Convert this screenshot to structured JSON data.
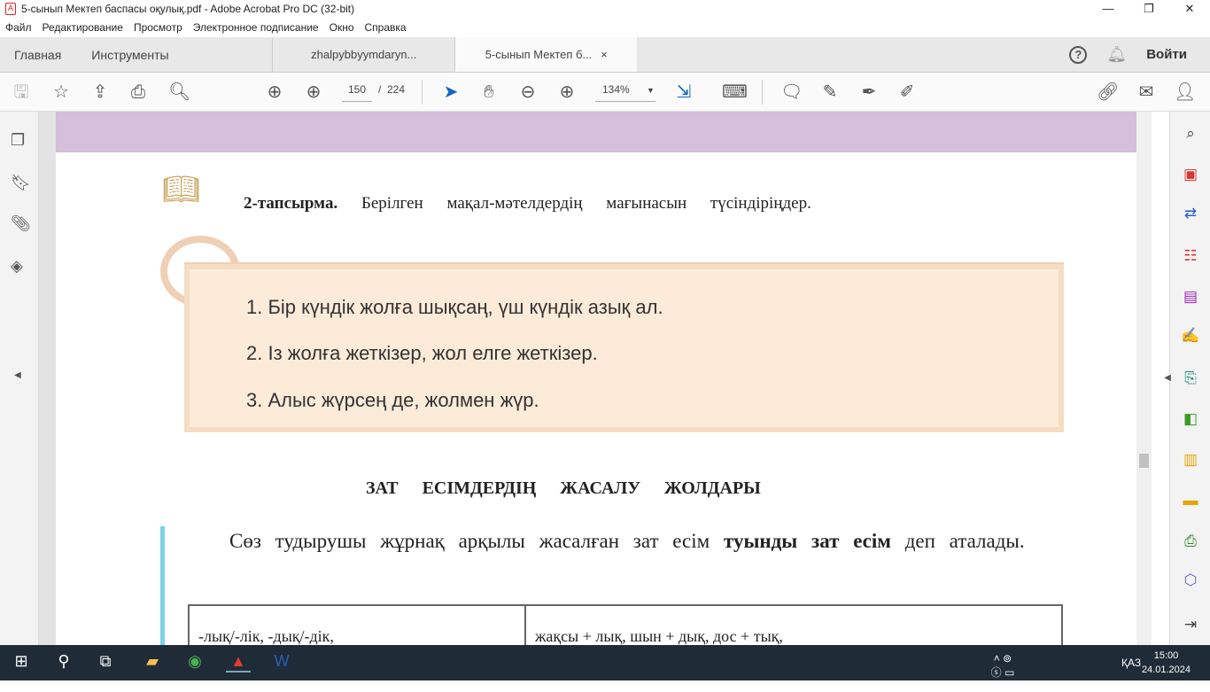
{
  "window": {
    "title": "5-сынып Мектеп баспасы оқулық.pdf - Adobe Acrobat Pro DC (32-bit)",
    "minimize": "—",
    "maximize": "❐",
    "close": "✕"
  },
  "menu": [
    "Файл",
    "Редактирование",
    "Просмотр",
    "Электронное подписание",
    "Окно",
    "Справка"
  ],
  "tabs": {
    "home": "Главная",
    "tools": "Инструменты",
    "docs": [
      {
        "label": "zhalpybbyymdaryn..."
      },
      {
        "label": "5-сынып Мектеп б...",
        "close": "×"
      }
    ],
    "help": "?",
    "login": "Войти"
  },
  "toolbar": {
    "page_current": "150",
    "page_sep": "/",
    "page_total": "224",
    "zoom": "134%"
  },
  "document": {
    "task_label": "2-тапсырма.",
    "task_text": "Берілген мақал-мәтелдердің мағынасын түсіндіріңдер.",
    "proverbs": [
      "1. Бір күндік жолға шықсаң, үш күндік азық ал.",
      "2. Із жолға жеткізер, жол елге жеткізер.",
      "3. Алыс жүрсең де, жолмен жүр."
    ],
    "heading": "ЗАТ ЕСІМДЕРДІҢ ЖАСАЛУ ЖОЛДАРЫ",
    "para_start": "Сөз тудырушы жұрнақ арқылы жасалған зат есім ",
    "para_bold": "туынды зат есім",
    "para_end": " деп аталады.",
    "table_row": [
      "-лық/-лік, -дық/-дік,",
      "жақсы + лық, шын + дық, дос + тық,"
    ]
  },
  "taskbar": {
    "lang": "ҚАЗ",
    "time": "15:00",
    "date": "24.01.2024"
  }
}
